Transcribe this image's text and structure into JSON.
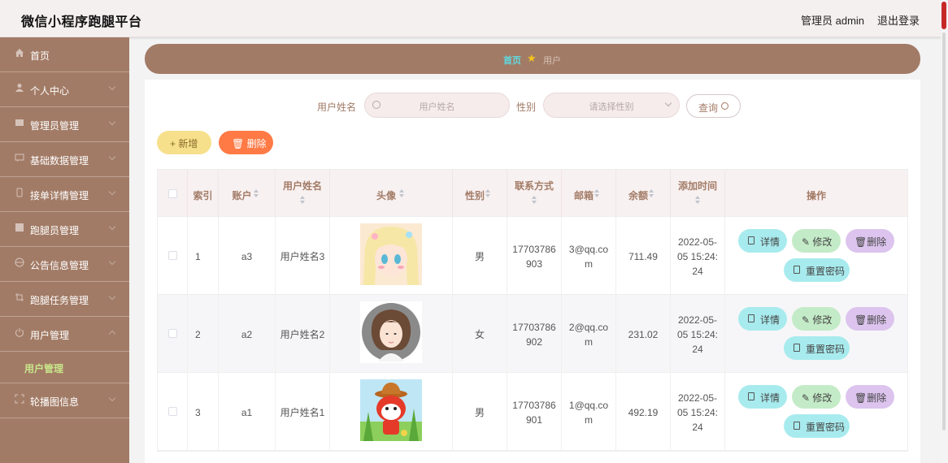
{
  "header": {
    "title": "微信小程序跑腿平台",
    "admin_label": "管理员 admin",
    "logout_label": "退出登录"
  },
  "sidebar": {
    "items": [
      {
        "label": "首页",
        "icon": "home-icon"
      },
      {
        "label": "个人中心",
        "icon": "user-icon"
      },
      {
        "label": "管理员管理",
        "icon": "list-icon"
      },
      {
        "label": "基础数据管理",
        "icon": "chat-icon"
      },
      {
        "label": "接单详情管理",
        "icon": "phone-icon"
      },
      {
        "label": "跑腿员管理",
        "icon": "check-icon"
      },
      {
        "label": "公告信息管理",
        "icon": "globe-icon"
      },
      {
        "label": "跑腿任务管理",
        "icon": "crop-icon"
      },
      {
        "label": "用户管理",
        "icon": "power-icon"
      },
      {
        "label": "轮播图信息",
        "icon": "expand-icon"
      }
    ],
    "active_sub": "用户管理"
  },
  "breadcrumb": {
    "home": "首页",
    "current": "用户"
  },
  "filters": {
    "name_label": "用户姓名",
    "name_placeholder": "用户姓名",
    "gender_label": "性别",
    "gender_placeholder": "请选择性别",
    "query_label": "查询"
  },
  "actions": {
    "add_label": "新增",
    "delete_label": "删除"
  },
  "table": {
    "headers": {
      "index": "索引",
      "account": "账户",
      "name": "用户姓名",
      "avatar": "头像",
      "gender": "性别",
      "contact": "联系方式",
      "email": "邮箱",
      "balance": "余额",
      "added": "添加时间",
      "ops": "操作"
    },
    "rows": [
      {
        "index": "1",
        "account": "a3",
        "name": "用户姓名3",
        "gender": "男",
        "phone1": "17703786",
        "phone2": "903",
        "email1": "3@qq.co",
        "email2": "m",
        "balance": "711.49",
        "t1": "2022-05-",
        "t2": "05 15:24:",
        "t3": "24"
      },
      {
        "index": "2",
        "account": "a2",
        "name": "用户姓名2",
        "gender": "女",
        "phone1": "17703786",
        "phone2": "902",
        "email1": "2@qq.co",
        "email2": "m",
        "balance": "231.02",
        "t1": "2022-05-",
        "t2": "05 15:24:",
        "t3": "24"
      },
      {
        "index": "3",
        "account": "a1",
        "name": "用户姓名1",
        "gender": "男",
        "phone1": "17703786",
        "phone2": "901",
        "email1": "1@qq.co",
        "email2": "m",
        "balance": "492.19",
        "t1": "2022-05-",
        "t2": "05 15:24:",
        "t3": "24"
      }
    ],
    "op_labels": {
      "detail": "详情",
      "edit": "修改",
      "delete": "删除",
      "reset": "重置密码"
    }
  },
  "colors": {
    "brand": "#a27b66",
    "accent": "#5fd9e0",
    "delete": "#ff7a45",
    "add": "#f6e08c"
  }
}
